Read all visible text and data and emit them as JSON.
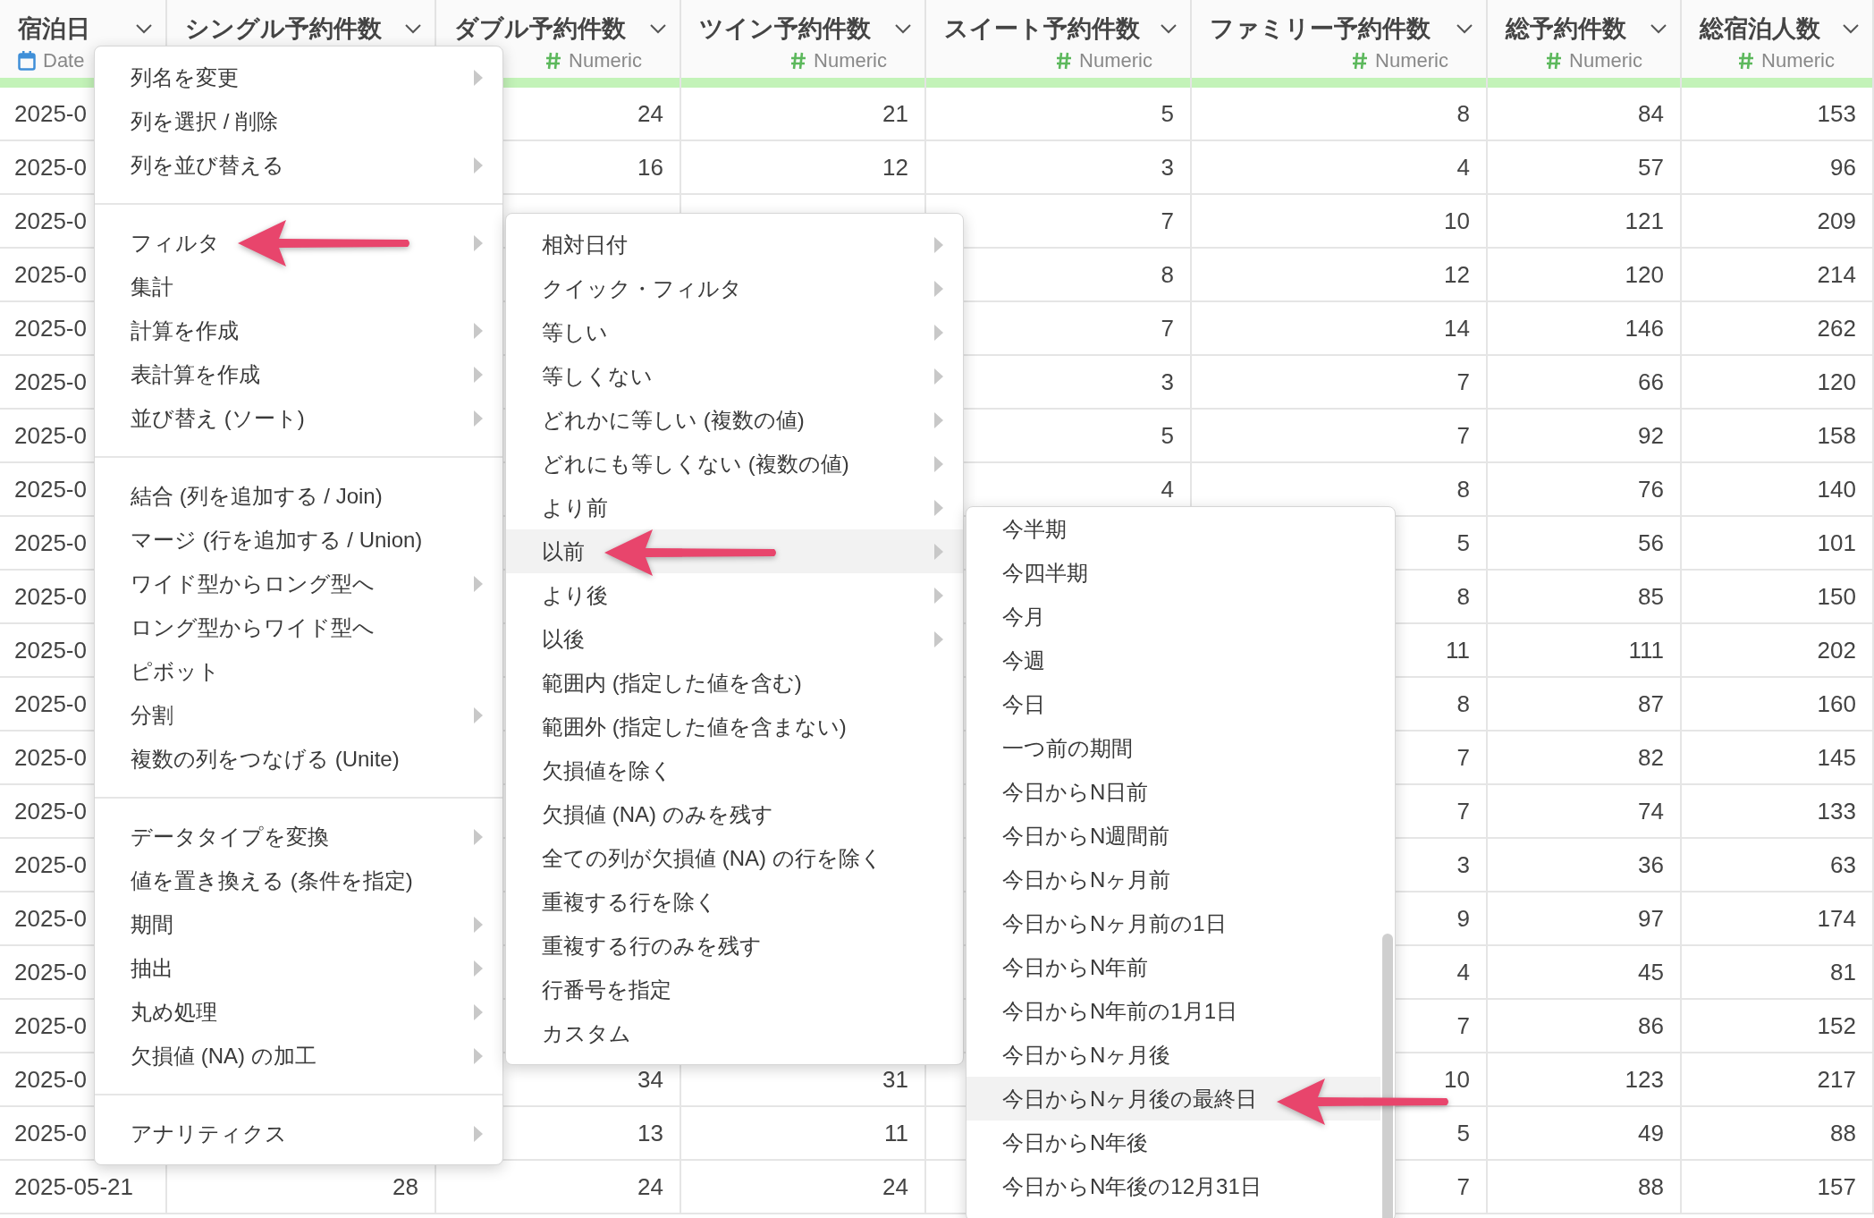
{
  "table": {
    "columns": [
      {
        "title": "宿泊日",
        "kind": "date",
        "type_label": "Date"
      },
      {
        "title": "シングル予約件数",
        "kind": "numeric"
      },
      {
        "title": "ダブル予約件数",
        "kind": "numeric",
        "type_label": "Numeric"
      },
      {
        "title": "ツイン予約件数",
        "kind": "numeric",
        "type_label": "Numeric"
      },
      {
        "title": "スイート予約件数",
        "kind": "numeric",
        "type_label": "Numeric"
      },
      {
        "title": "ファミリー予約件数",
        "kind": "numeric",
        "type_label": "Numeric"
      },
      {
        "title": "総予約件数",
        "kind": "numeric",
        "type_label": "Numeric"
      },
      {
        "title": "総宿泊人数",
        "kind": "numeric",
        "type_label": "Numeric"
      }
    ],
    "rows": [
      [
        "2025-0",
        null,
        "24",
        "21",
        "5",
        "8",
        "84",
        "153"
      ],
      [
        "2025-0",
        null,
        "16",
        "12",
        "3",
        "4",
        "57",
        "96"
      ],
      [
        "2025-0",
        null,
        null,
        null,
        "7",
        "10",
        "121",
        "209"
      ],
      [
        "2025-0",
        null,
        null,
        null,
        "8",
        "12",
        "120",
        "214"
      ],
      [
        "2025-0",
        null,
        null,
        null,
        "7",
        "14",
        "146",
        "262"
      ],
      [
        "2025-0",
        null,
        null,
        null,
        "3",
        "7",
        "66",
        "120"
      ],
      [
        "2025-0",
        null,
        null,
        null,
        "5",
        "7",
        "92",
        "158"
      ],
      [
        "2025-0",
        null,
        null,
        null,
        "4",
        "8",
        "76",
        "140"
      ],
      [
        "2025-0",
        null,
        null,
        null,
        null,
        "5",
        "56",
        "101"
      ],
      [
        "2025-0",
        null,
        null,
        null,
        null,
        "8",
        "85",
        "150"
      ],
      [
        "2025-0",
        null,
        null,
        null,
        null,
        "11",
        "111",
        "202"
      ],
      [
        "2025-0",
        null,
        null,
        null,
        null,
        "8",
        "87",
        "160"
      ],
      [
        "2025-0",
        null,
        null,
        null,
        null,
        "7",
        "82",
        "145"
      ],
      [
        "2025-0",
        null,
        null,
        null,
        null,
        "7",
        "74",
        "133"
      ],
      [
        "2025-0",
        null,
        null,
        null,
        null,
        "3",
        "36",
        "63"
      ],
      [
        "2025-0",
        null,
        null,
        null,
        null,
        "9",
        "97",
        "174"
      ],
      [
        "2025-0",
        null,
        null,
        null,
        null,
        "4",
        "45",
        "81"
      ],
      [
        "2025-0",
        null,
        null,
        null,
        null,
        "7",
        "86",
        "152"
      ],
      [
        "2025-0",
        null,
        "34",
        "31",
        null,
        "10",
        "123",
        "217"
      ],
      [
        "2025-0",
        null,
        "13",
        "11",
        null,
        "5",
        "49",
        "88"
      ],
      [
        "2025-05-21",
        "28",
        "24",
        "24",
        null,
        "7",
        "88",
        "157"
      ]
    ]
  },
  "column_menu": {
    "groups": [
      [
        {
          "label": "列名を変更",
          "submenu": true
        },
        {
          "label": "列を選択 / 削除",
          "submenu": false
        },
        {
          "label": "列を並び替える",
          "submenu": true
        }
      ],
      [
        {
          "label": "フィルタ",
          "submenu": true
        },
        {
          "label": "集計",
          "submenu": false
        },
        {
          "label": "計算を作成",
          "submenu": true
        },
        {
          "label": "表計算を作成",
          "submenu": true
        },
        {
          "label": "並び替え (ソート)",
          "submenu": true
        }
      ],
      [
        {
          "label": "結合 (列を追加する / Join)",
          "submenu": false
        },
        {
          "label": "マージ (行を追加する / Union)",
          "submenu": false
        },
        {
          "label": "ワイド型からロング型へ",
          "submenu": true
        },
        {
          "label": "ロング型からワイド型へ",
          "submenu": false
        },
        {
          "label": "ピボット",
          "submenu": false
        },
        {
          "label": "分割",
          "submenu": true
        },
        {
          "label": "複数の列をつなげる (Unite)",
          "submenu": false
        }
      ],
      [
        {
          "label": "データタイプを変換",
          "submenu": true
        },
        {
          "label": "値を置き換える (条件を指定)",
          "submenu": false
        },
        {
          "label": "期間",
          "submenu": true
        },
        {
          "label": "抽出",
          "submenu": true
        },
        {
          "label": "丸め処理",
          "submenu": true
        },
        {
          "label": "欠損値 (NA) の加工",
          "submenu": true
        }
      ],
      [
        {
          "label": "アナリティクス",
          "submenu": true
        }
      ]
    ]
  },
  "filter_menu": {
    "items": [
      {
        "label": "相対日付",
        "submenu": true,
        "selected": false
      },
      {
        "label": "クイック・フィルタ",
        "submenu": true,
        "selected": false
      },
      {
        "label": "等しい",
        "submenu": true,
        "selected": false
      },
      {
        "label": "等しくない",
        "submenu": true,
        "selected": false
      },
      {
        "label": "どれかに等しい (複数の値)",
        "submenu": true,
        "selected": false
      },
      {
        "label": "どれにも等しくない (複数の値)",
        "submenu": true,
        "selected": false
      },
      {
        "label": "より前",
        "submenu": true,
        "selected": false
      },
      {
        "label": "以前",
        "submenu": true,
        "selected": true
      },
      {
        "label": "より後",
        "submenu": true,
        "selected": false
      },
      {
        "label": "以後",
        "submenu": true,
        "selected": false
      },
      {
        "label": "範囲内 (指定した値を含む)",
        "submenu": false,
        "selected": false
      },
      {
        "label": "範囲外 (指定した値を含まない)",
        "submenu": false,
        "selected": false
      },
      {
        "label": "欠損値を除く",
        "submenu": false,
        "selected": false
      },
      {
        "label": "欠損値 (NA) のみを残す",
        "submenu": false,
        "selected": false
      },
      {
        "label": "全ての列が欠損値 (NA) の行を除く",
        "submenu": false,
        "selected": false
      },
      {
        "label": "重複する行を除く",
        "submenu": false,
        "selected": false
      },
      {
        "label": "重複する行のみを残す",
        "submenu": false,
        "selected": false
      },
      {
        "label": "行番号を指定",
        "submenu": false,
        "selected": false
      },
      {
        "label": "カスタム",
        "submenu": false,
        "selected": false
      }
    ]
  },
  "period_menu": {
    "items": [
      {
        "label": "今半期",
        "selected": false
      },
      {
        "label": "今四半期",
        "selected": false
      },
      {
        "label": "今月",
        "selected": false
      },
      {
        "label": "今週",
        "selected": false
      },
      {
        "label": "今日",
        "selected": false
      },
      {
        "label": "一つ前の期間",
        "selected": false
      },
      {
        "label": "今日からN日前",
        "selected": false
      },
      {
        "label": "今日からN週間前",
        "selected": false
      },
      {
        "label": "今日からNヶ月前",
        "selected": false
      },
      {
        "label": "今日からNヶ月前の1日",
        "selected": false
      },
      {
        "label": "今日からN年前",
        "selected": false
      },
      {
        "label": "今日からN年前の1月1日",
        "selected": false
      },
      {
        "label": "今日からNヶ月後",
        "selected": false
      },
      {
        "label": "今日からNヶ月後の最終日",
        "selected": true
      },
      {
        "label": "今日からN年後",
        "selected": false
      },
      {
        "label": "今日からN年後の12月31日",
        "selected": false
      }
    ]
  }
}
